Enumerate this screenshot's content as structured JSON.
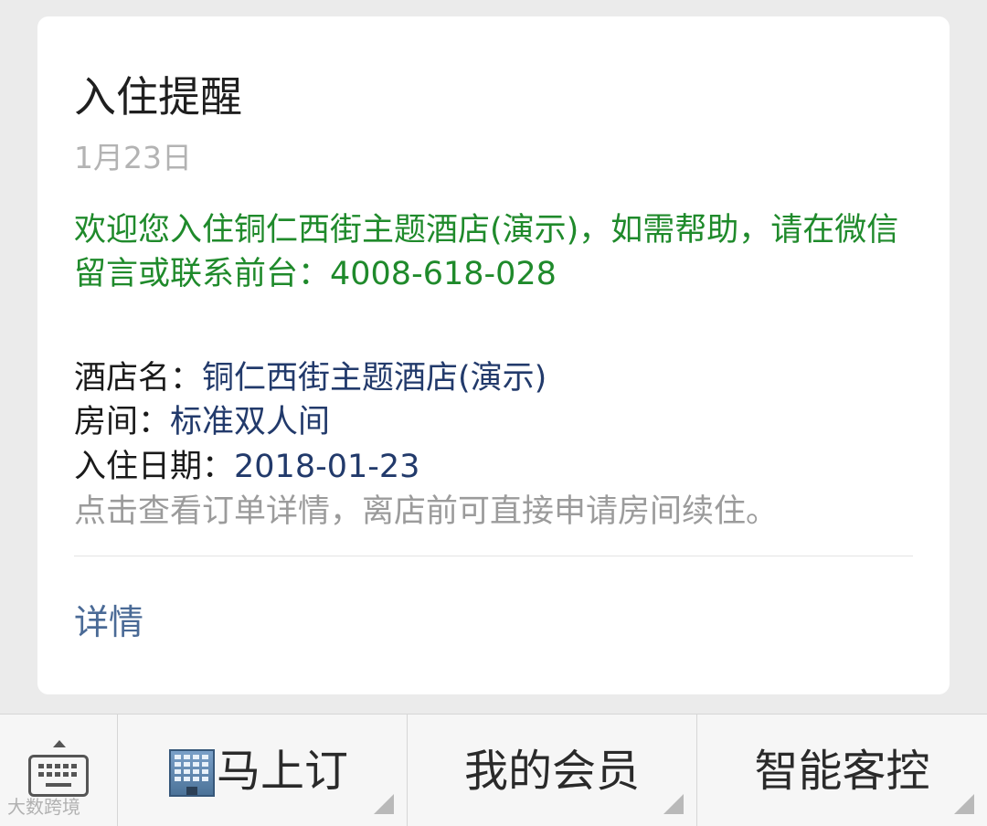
{
  "card": {
    "title": "入住提醒",
    "date": "1月23日",
    "greeting": "欢迎您入住铜仁西街主题酒店(演示)，如需帮助，请在微信留言或联系前台：4008-618-028",
    "fields": {
      "hotel_label": "酒店名：",
      "hotel_value": "铜仁西街主题酒店(演示)",
      "room_label": "房间：",
      "room_value": "标准双人间",
      "checkin_label": "入住日期：",
      "checkin_value": "2018-01-23"
    },
    "hint": "点击查看订单详情，离店前可直接申请房间续住。",
    "details_link": "详情"
  },
  "menu": {
    "keyboard_icon": "keyboard-icon",
    "buttons": [
      {
        "label": "马上订",
        "icon": "building-icon"
      },
      {
        "label": "我的会员"
      },
      {
        "label": "智能客控"
      }
    ]
  },
  "watermark": "大数跨境",
  "colors": {
    "background": "#ebebeb",
    "card": "#ffffff",
    "greeting_green": "#1f8a2b",
    "value_navy": "#223a6b",
    "link_blue": "#4a6a96",
    "muted_gray": "#9b9b9b"
  }
}
